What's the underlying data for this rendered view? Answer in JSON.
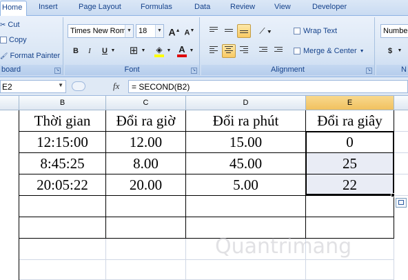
{
  "tabs": [
    "Home",
    "Insert",
    "Page Layout",
    "Formulas",
    "Data",
    "Review",
    "View",
    "Developer"
  ],
  "clipboard": {
    "cut": "Cut",
    "copy": "Copy",
    "format_painter": "Format Painter",
    "label": "board"
  },
  "font": {
    "name": "Times New Rom",
    "size": "18",
    "grow": "A",
    "shrink": "A",
    "bold": "B",
    "italic": "I",
    "underline": "U",
    "color_letter": "A",
    "label": "Font"
  },
  "alignment": {
    "wrap_text": "Wrap Text",
    "merge_center": "Merge & Center",
    "label": "Alignment"
  },
  "number": {
    "format": "Numbe",
    "currency": "$",
    "label": "N"
  },
  "formula_bar": {
    "name_box": "E2",
    "fx": "fx",
    "formula": "= SECOND(B2)"
  },
  "columns": [
    "B",
    "C",
    "D",
    "E"
  ],
  "table": {
    "headers": [
      "Thời gian",
      "Đổi ra giờ",
      "Đổi ra phút",
      "Đổi ra giây"
    ],
    "rows": [
      [
        "12:15:00",
        "12.00",
        "15.00",
        "0"
      ],
      [
        "8:45:25",
        "8.00",
        "45.00",
        "25"
      ],
      [
        "20:05:22",
        "20.00",
        "5.00",
        "22"
      ],
      [
        "",
        "",
        "",
        ""
      ],
      [
        "",
        "",
        "",
        ""
      ]
    ]
  },
  "watermark": "Quantrimang",
  "colors": {
    "ribbon_text": "#15428b",
    "selected_header": "#f1c15f",
    "selection_fill": "#e9ecf5"
  }
}
